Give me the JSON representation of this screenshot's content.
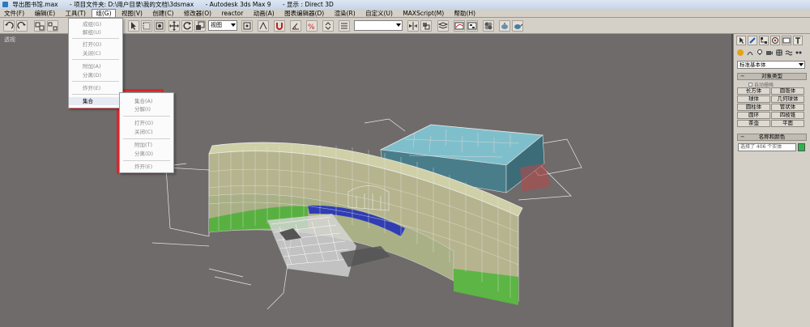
{
  "titlebar": {
    "file": "导出图书馆.max",
    "project": "- 项目文件夹: D:\\用户目录\\我的文档\\3dsmax",
    "app": "- Autodesk 3ds Max 9",
    "display": "- 显示 : Direct 3D"
  },
  "menubar": {
    "items": [
      "文件(F)",
      "编辑(E)",
      "工具(T)",
      "组(G)",
      "视图(V)",
      "创建(C)",
      "修改器(O)",
      "reactor",
      "动画(A)",
      "图表编辑器(D)",
      "渲染(R)",
      "自定义(U)",
      "MAXScript(M)",
      "帮助(H)"
    ]
  },
  "toolbar": {
    "view_select": "视图",
    "blank_select": ""
  },
  "viewport": {
    "label": "透视"
  },
  "group_menu": {
    "items": [
      "成组(G)",
      "解组(U)",
      "打开(O)",
      "关闭(C)",
      "附加(A)",
      "分离(D)",
      "炸开(E)",
      "集合"
    ]
  },
  "submenu": {
    "items": [
      "集合(A)",
      "分解(I)",
      "打开(O)",
      "关闭(C)",
      "附加(T)",
      "分离(D)",
      "炸开(E)"
    ]
  },
  "command_panel": {
    "category": "标准基本体",
    "object_type_header": "对象类型",
    "autogrid": "自动栅格",
    "objects": [
      "长方体",
      "圆锥体",
      "球体",
      "几何球体",
      "圆柱体",
      "管状体",
      "圆环",
      "四棱锥",
      "茶壶",
      "平面"
    ],
    "name_color_header": "名称和颜色",
    "name_value": "选择了 406 个实体"
  },
  "colors": {
    "viewport_bg": "#6e6b6a",
    "highlight": "#d9262b",
    "swatch": "#28b54a"
  }
}
